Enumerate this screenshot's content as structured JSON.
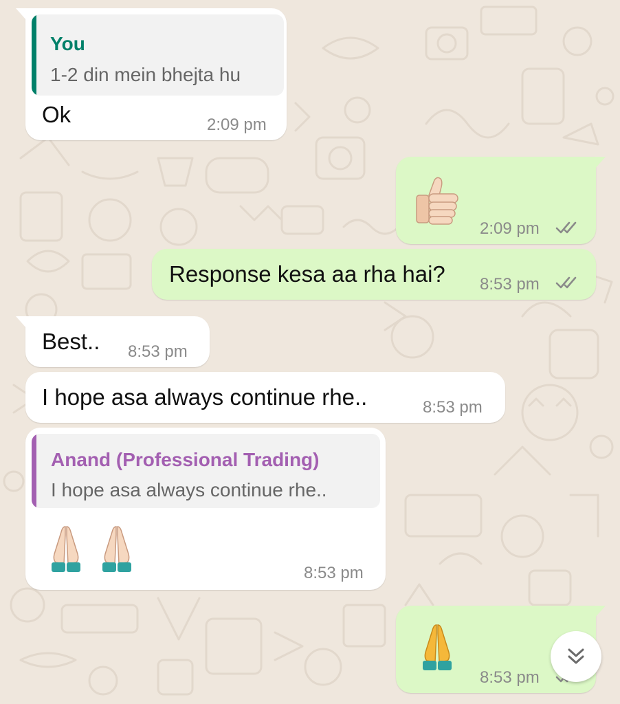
{
  "theme": {
    "chat_background": "#efe7dd",
    "incoming_bubble": "#ffffff",
    "outgoing_bubble": "#dcf8c6",
    "quote_you_color": "#008069",
    "quote_contact_color": "#a35fb1",
    "tick_color": "#8a8a8a"
  },
  "messages": [
    {
      "direction": "incoming",
      "quote": {
        "author": "You",
        "text": "1-2 din mein bhejta hu"
      },
      "text": "Ok",
      "time": "2:09 pm"
    },
    {
      "direction": "outgoing",
      "emoji": "thumbs-up",
      "time": "2:09 pm",
      "status": "read-double-tick"
    },
    {
      "direction": "outgoing",
      "text": "Response kesa aa rha hai?",
      "time": "8:53 pm",
      "status": "read-double-tick"
    },
    {
      "direction": "incoming",
      "text": "Best..",
      "time": "8:53 pm"
    },
    {
      "direction": "incoming",
      "text": "I hope asa always continue rhe..",
      "time": "8:53 pm"
    },
    {
      "direction": "incoming",
      "quote": {
        "author": "Anand (Professional Trading)",
        "text": "I hope asa always continue rhe.."
      },
      "emoji": "folded-hands-x2",
      "time": "8:53 pm"
    },
    {
      "direction": "outgoing",
      "emoji": "folded-hands",
      "time": "8:53 pm",
      "status": "read-double-tick"
    }
  ],
  "scroll_button": {
    "icon": "double-chevron-down-icon"
  }
}
